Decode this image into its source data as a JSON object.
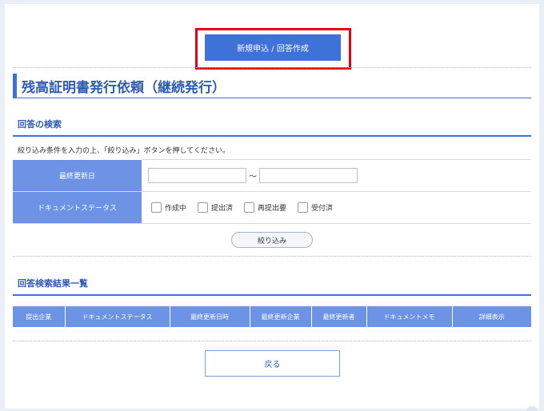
{
  "header": {
    "new_request_label": "新規申込 / 回答作成"
  },
  "page_title": "残高証明書発行依頼（継続発行）",
  "search": {
    "title": "回答の検索",
    "instruction": "絞り込み条件を入力の上、「絞り込み」ボタンを押してください。",
    "last_updated_label": "最終更新日",
    "date_from_value": "",
    "date_to_value": "",
    "range_separator": "～",
    "status_label": "ドキュメントステータス",
    "status_options": [
      {
        "label": "作成中",
        "checked": false
      },
      {
        "label": "提出済",
        "checked": false
      },
      {
        "label": "再提出要",
        "checked": false
      },
      {
        "label": "受付済",
        "checked": false
      }
    ],
    "filter_label": "絞り込み"
  },
  "results": {
    "title": "回答検索結果一覧",
    "columns": [
      "提出企業",
      "ドキュメントステータス",
      "最終更新日時",
      "最終更新企業",
      "最終更新者",
      "ドキュメントメモ",
      "詳細表示"
    ]
  },
  "footer": {
    "back_label": "戻る"
  },
  "colors": {
    "accent": "#3f72d8",
    "header_cell": "#6c93e6",
    "highlight": "#e60012"
  }
}
